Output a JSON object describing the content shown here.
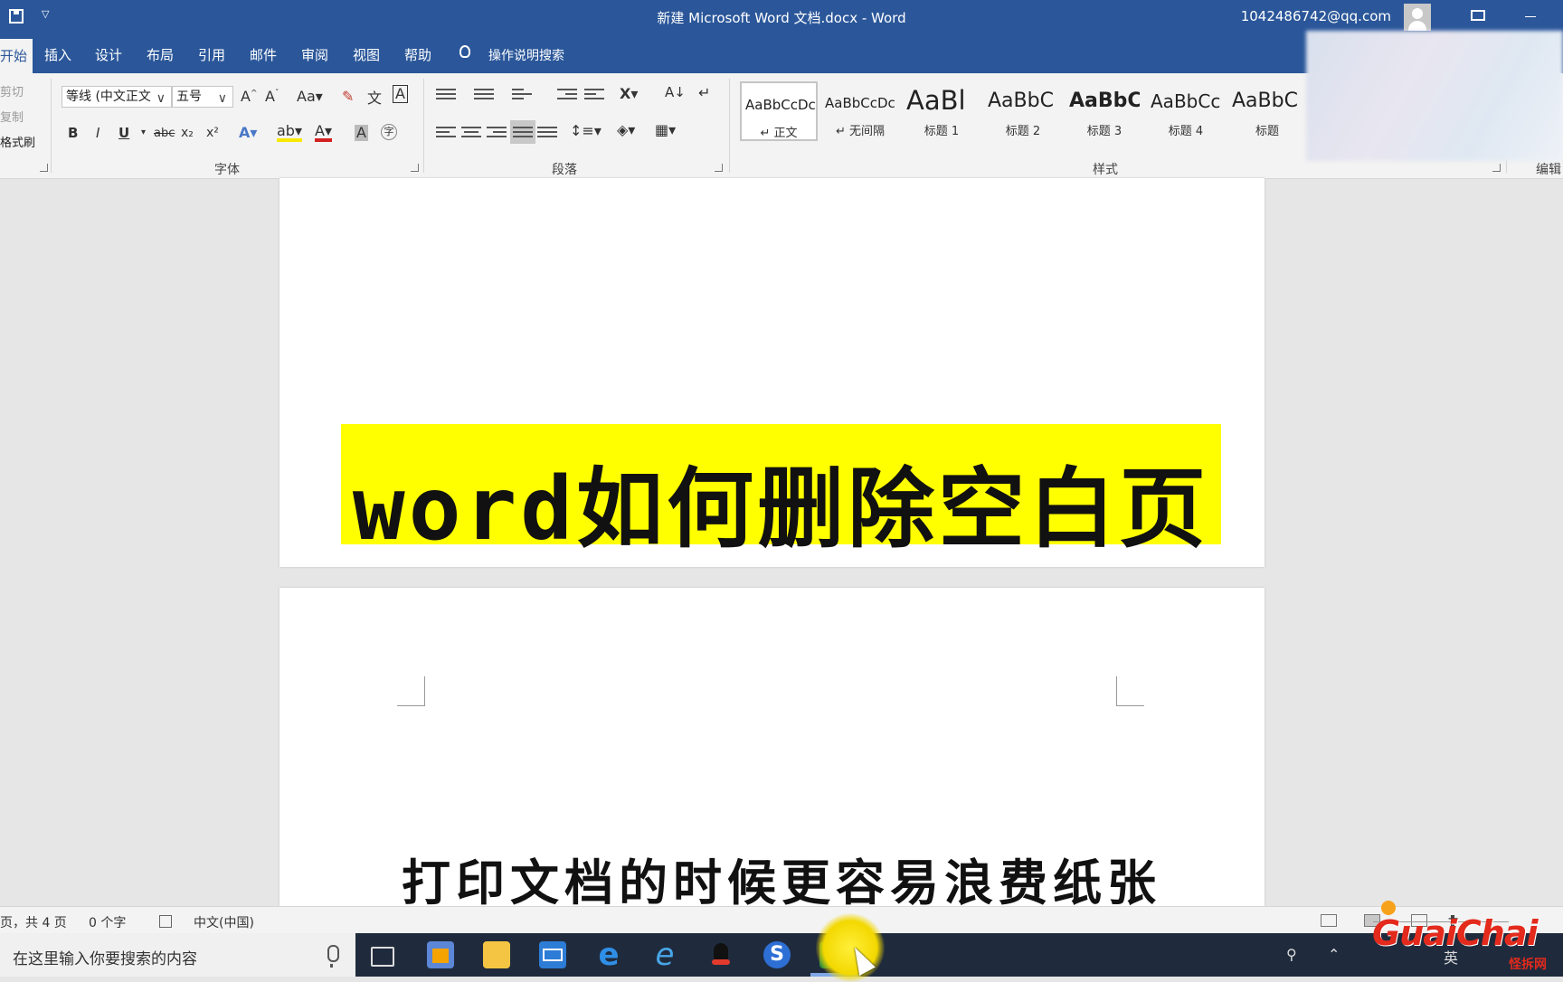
{
  "window": {
    "title": "新建 Microsoft Word 文档.docx  -  Word",
    "user": "1042486742@qq.com"
  },
  "tabs": [
    "开始",
    "插入",
    "设计",
    "布局",
    "引用",
    "邮件",
    "审阅",
    "视图",
    "帮助"
  ],
  "tell_me": "操作说明搜索",
  "clipboard": {
    "cut": "剪切",
    "copy": "复制",
    "format_painter": "格式刷"
  },
  "font": {
    "name": "等线 (中文正文",
    "size": "五号",
    "group_label": "字体",
    "bold": "B",
    "italic": "I",
    "underline": "U",
    "strike": "abc",
    "subscript": "x₂",
    "superscript": "x²",
    "clear": "A"
  },
  "paragraph": {
    "group_label": "段落"
  },
  "styles": {
    "group_label": "样式",
    "items": [
      {
        "preview": "AaBbCcDc",
        "name": "↵ 正文"
      },
      {
        "preview": "AaBbCcDc",
        "name": "↵ 无间隔"
      },
      {
        "preview": "AaBl",
        "name": "标题 1"
      },
      {
        "preview": "AaBbC",
        "name": "标题 2"
      },
      {
        "preview": "AaBbC",
        "name": "标题 3"
      },
      {
        "preview": "AaBbCc",
        "name": "标题 4"
      },
      {
        "preview": "AaBbC",
        "name": "标题"
      }
    ]
  },
  "editing": {
    "group_label": "编辑"
  },
  "document": {
    "banner": "word如何删除空白页",
    "subtitle": "打印文档的时候更容易浪费纸张"
  },
  "status": {
    "pages": "页，共 4 页",
    "words": "0 个字",
    "language": "中文(中国)"
  },
  "taskbar": {
    "search_placeholder": "在这里输入你要搜索的内容"
  },
  "tray": {
    "ime": "英"
  },
  "watermark": {
    "brand": "GuaiChai",
    "sub": "怪拆网"
  },
  "colors": {
    "accent": "#2b579a",
    "banner": "#ffff00"
  }
}
